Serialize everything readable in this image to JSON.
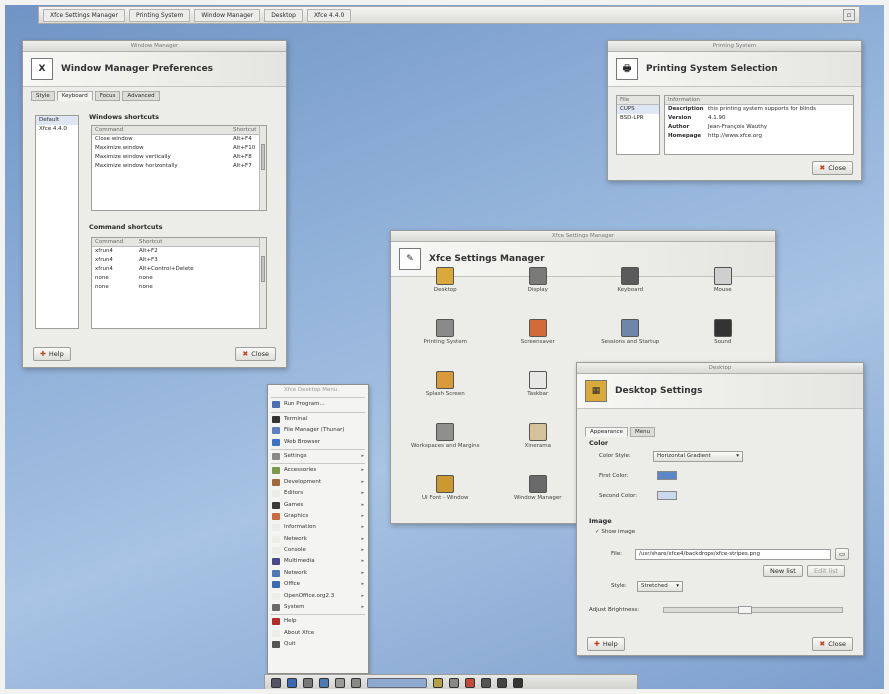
{
  "top_panel": {
    "tasks": [
      {
        "label": "Xfce Settings Manager"
      },
      {
        "label": "Printing System"
      },
      {
        "label": "Window Manager"
      },
      {
        "label": "Desktop"
      },
      {
        "label": "Xfce 4.4.0"
      }
    ]
  },
  "wm_prefs": {
    "window_title": "Window Manager",
    "title": "Window Manager Preferences",
    "icon_text": "X",
    "tabs": [
      "Style",
      "Keyboard",
      "Focus",
      "Advanced"
    ],
    "themes": [
      "Default",
      "Xfce 4.4.0"
    ],
    "windows_shortcuts_title": "Windows shortcuts",
    "windows_shortcuts_header": [
      "Command",
      "Shortcut"
    ],
    "windows_shortcuts": [
      {
        "action": "Close window",
        "key": "Alt+F4"
      },
      {
        "action": "Maximize window",
        "key": "Alt+F10"
      },
      {
        "action": "Maximize window vertically",
        "key": "Alt+F8"
      },
      {
        "action": "Maximize window horizontally",
        "key": "Alt+F7"
      }
    ],
    "command_shortcuts_title": "Command shortcuts",
    "command_shortcuts_header": [
      "Command",
      "Shortcut"
    ],
    "command_shortcuts": [
      {
        "cmd": "xfrun4",
        "key": "Alt+F2"
      },
      {
        "cmd": "xfrun4",
        "key": "Alt+F3"
      },
      {
        "cmd": "xfrun4",
        "key": "Alt+Control+Delete"
      },
      {
        "cmd": "none",
        "key": "none"
      },
      {
        "cmd": "none",
        "key": "none"
      }
    ],
    "help_label": "Help",
    "close_label": "Close"
  },
  "printing": {
    "window_title": "Printing System",
    "title": "Printing System Selection",
    "list_header": "File",
    "list": [
      "CUPS",
      "BSD-LPR"
    ],
    "info_header": "Information",
    "info": [
      {
        "k": "Description",
        "v": "this printing system supports for blinds"
      },
      {
        "k": "Version",
        "v": "4.1.90"
      },
      {
        "k": "Author",
        "v": "Jean-François Wauthy"
      },
      {
        "k": "Homepage",
        "v": "http://www.xfce.org"
      }
    ],
    "close_label": "Close"
  },
  "settings_manager": {
    "window_title": "Xfce Settings Manager",
    "title": "Xfce Settings Manager",
    "items": [
      {
        "label": "Desktop",
        "icon": "desktop-icon",
        "color": "#d9a93a"
      },
      {
        "label": "Display",
        "icon": "display-icon",
        "color": "#7a7a78"
      },
      {
        "label": "Keyboard",
        "icon": "keyboard-icon",
        "color": "#5a5a5a"
      },
      {
        "label": "Mouse",
        "icon": "mouse-icon",
        "color": "#cfcfcf"
      },
      {
        "label": "Printing System",
        "icon": "printer-icon",
        "color": "#8a8a8a"
      },
      {
        "label": "Screensaver",
        "icon": "screensaver-icon",
        "color": "#d36a3a"
      },
      {
        "label": "Sessions and Startup",
        "icon": "sessions-icon",
        "color": "#6f86a8"
      },
      {
        "label": "Sound",
        "icon": "sound-icon",
        "color": "#333333"
      },
      {
        "label": "Splash Screen",
        "icon": "splash-icon",
        "color": "#d99a3a"
      },
      {
        "label": "Taskbar",
        "icon": "taskbar-icon",
        "color": "#e7e7e5"
      },
      {
        "label": "",
        "icon": "blank-icon",
        "color": "#ecece9"
      },
      {
        "label": "",
        "icon": "blank-icon",
        "color": "#ecece9"
      },
      {
        "label": "Workspaces and Margins",
        "icon": "workspaces-icon",
        "color": "#8f8f8d"
      },
      {
        "label": "Xinerama",
        "icon": "xinerama-icon",
        "color": "#d3c29a"
      },
      {
        "label": "",
        "icon": "blank-icon",
        "color": "#ecece9"
      },
      {
        "label": "",
        "icon": "blank-icon",
        "color": "#ecece9"
      },
      {
        "label": "UI Font - Window",
        "icon": "font-icon",
        "color": "#c9982e"
      },
      {
        "label": "Window Manager",
        "icon": "window-manager-icon",
        "color": "#6a6a6a"
      }
    ]
  },
  "desktop_settings": {
    "window_title": "Desktop",
    "title": "Desktop Settings",
    "tabs": [
      "Appearance",
      "Menu"
    ],
    "color_section": "Color",
    "color_style_label": "Color Style:",
    "color_style_value": "Horizontal Gradient",
    "first_color_label": "First Color:",
    "first_color": "#5d86c9",
    "second_color_label": "Second Color:",
    "second_color": "#c9d8ee",
    "image_section": "Image",
    "show_image_label": "Show image",
    "file_label": "File:",
    "file_value": "/usr/share/xfce4/backdrops/xfce-stripes.png",
    "new_list_label": "New list",
    "edit_list_label": "Edit list",
    "style_label": "Style:",
    "style_value": "Stretched",
    "brightness_label": "Adjust Brightness:",
    "brightness_level": 0.45,
    "help_label": "Help",
    "close_label": "Close"
  },
  "start_menu": {
    "header": "Xfce Desktop Menu",
    "items": [
      {
        "label": "Run Program...",
        "icon": "run-icon",
        "color": "#4a6fb5",
        "sub": false,
        "sep_after": true
      },
      {
        "label": "Terminal",
        "icon": "terminal-icon",
        "color": "#333333",
        "sub": false
      },
      {
        "label": "File Manager (Thunar)",
        "icon": "file-manager-icon",
        "color": "#5b7fbf",
        "sub": false
      },
      {
        "label": "Web Browser",
        "icon": "web-browser-icon",
        "color": "#3a72c7",
        "sub": false,
        "sep_after": true
      },
      {
        "label": "Settings",
        "icon": "settings-icon",
        "color": "#8a8a8a",
        "sub": true,
        "sep_after": true
      },
      {
        "label": "Accessories",
        "icon": "accessories-icon",
        "color": "#7a9a4a",
        "sub": true
      },
      {
        "label": "Development",
        "icon": "development-icon",
        "color": "#a06a3a",
        "sub": true
      },
      {
        "label": "Editors",
        "icon": "editors-icon",
        "color": "#ecece9",
        "sub": true
      },
      {
        "label": "Games",
        "icon": "games-icon",
        "color": "#3a3a3a",
        "sub": true
      },
      {
        "label": "Graphics",
        "icon": "graphics-icon",
        "color": "#c96a3a",
        "sub": true
      },
      {
        "label": "Information",
        "icon": "information-icon",
        "color": "#ecece9",
        "sub": true
      },
      {
        "label": "Network",
        "icon": "network-icon",
        "color": "#ecece9",
        "sub": true
      },
      {
        "label": "Console",
        "icon": "console-icon",
        "color": "#ecece9",
        "sub": true
      },
      {
        "label": "Multimedia",
        "icon": "multimedia-icon",
        "color": "#4a4a8a",
        "sub": true
      },
      {
        "label": "Network",
        "icon": "network2-icon",
        "color": "#4a7ab5",
        "sub": true
      },
      {
        "label": "Office",
        "icon": "office-icon",
        "color": "#3a6ab5",
        "sub": true
      },
      {
        "label": "OpenOffice.org2.3",
        "icon": "openoffice-icon",
        "color": "#ecece9",
        "sub": true
      },
      {
        "label": "System",
        "icon": "system-icon",
        "color": "#6a6a6a",
        "sub": true,
        "sep_after": true
      },
      {
        "label": "Help",
        "icon": "help-icon",
        "color": "#b52a2a",
        "sub": false
      },
      {
        "label": "About Xfce",
        "icon": "about-icon",
        "color": "#ecece9",
        "sub": false
      },
      {
        "label": "Quit",
        "icon": "quit-icon",
        "color": "#555555",
        "sub": false
      }
    ]
  }
}
